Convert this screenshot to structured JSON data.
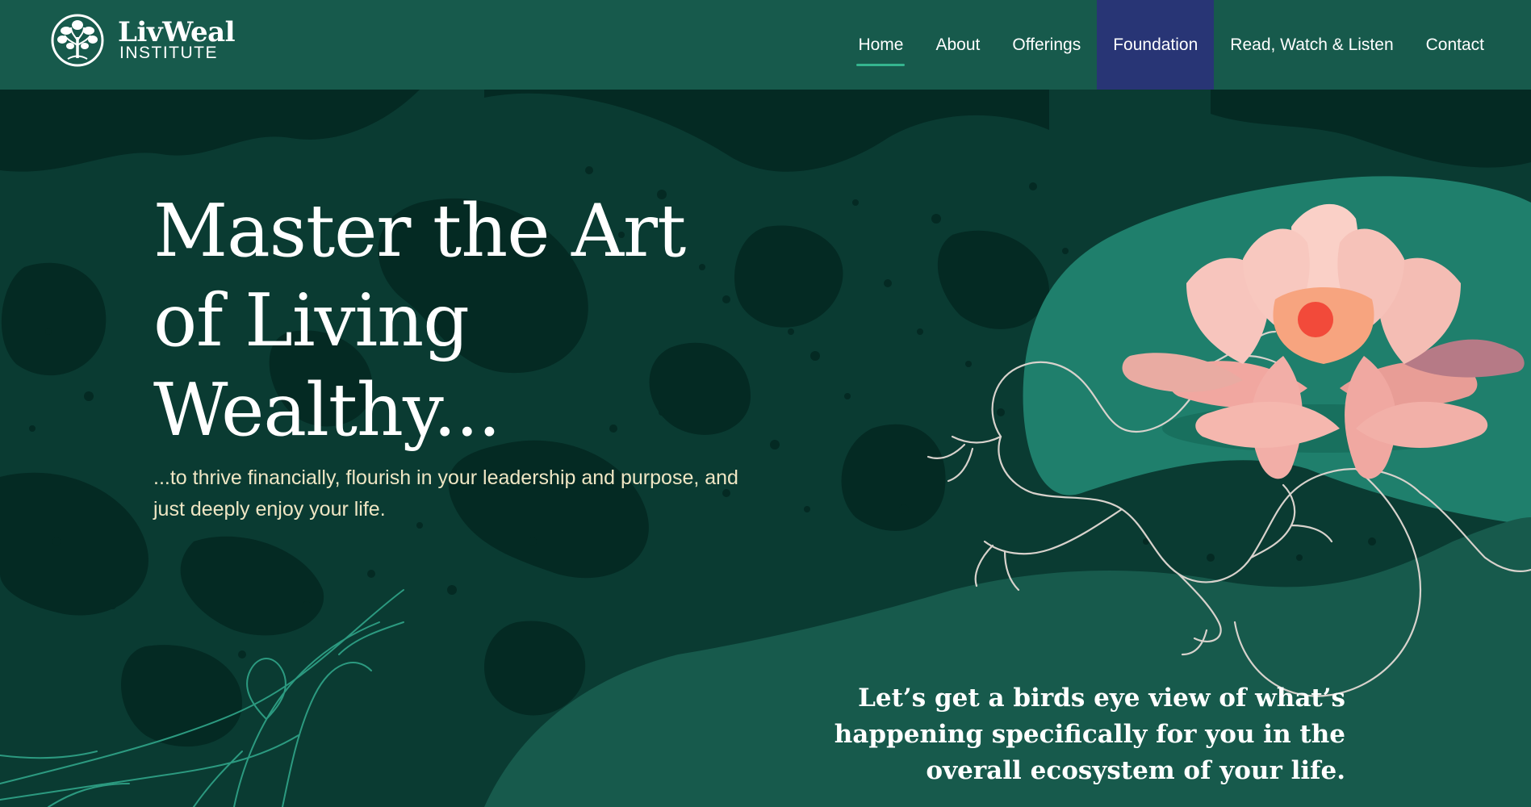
{
  "brand": {
    "name": "LivWeal",
    "subtitle": "INSTITUTE",
    "logo_icon": "tree-of-life-icon"
  },
  "nav": {
    "items": [
      {
        "label": "Home",
        "active": true
      },
      {
        "label": "About"
      },
      {
        "label": "Offerings"
      },
      {
        "label": "Foundation",
        "highlight_color": "#283575"
      },
      {
        "label": "Read, Watch & Listen"
      },
      {
        "label": "Contact"
      }
    ]
  },
  "hero": {
    "headline": "Master the Art of Living Wealthy...",
    "subheadline": "...to thrive financially, flourish in your leadership and purpose, and just deeply enjoy your life.",
    "callout": "Let’s get a birds eye view of what’s happening specifically for you in the overall ecosystem of your life.",
    "illustrations": [
      "lotus-flower-image",
      "frog-line-art",
      "water-plant-line-art"
    ]
  },
  "colors": {
    "header_bg": "#175a4c",
    "hero_bg": "#0a3b32",
    "accent": "#35b58f",
    "highlight": "#283575",
    "subtext": "#efe6c4"
  }
}
